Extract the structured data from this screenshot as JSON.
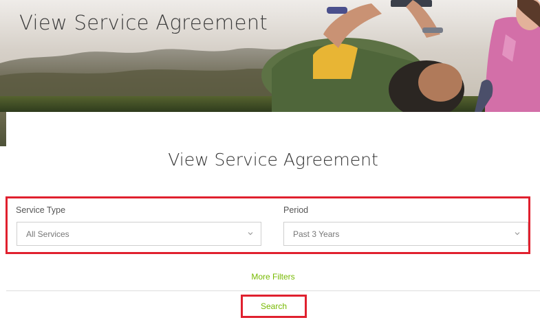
{
  "hero": {
    "title": "View Service Agreement"
  },
  "main": {
    "title": "View Service Agreement",
    "filters": {
      "service_type": {
        "label": "Service Type",
        "selected": "All Services",
        "icon": "chevron-down-icon"
      },
      "period": {
        "label": "Period",
        "selected": "Past 3 Years",
        "icon": "chevron-down-icon"
      }
    },
    "more_filters_label": "More Filters",
    "search_label": "Search"
  },
  "colors": {
    "accent_green": "#76b900",
    "highlight_red": "#e0202e",
    "title_text": "#333333"
  }
}
